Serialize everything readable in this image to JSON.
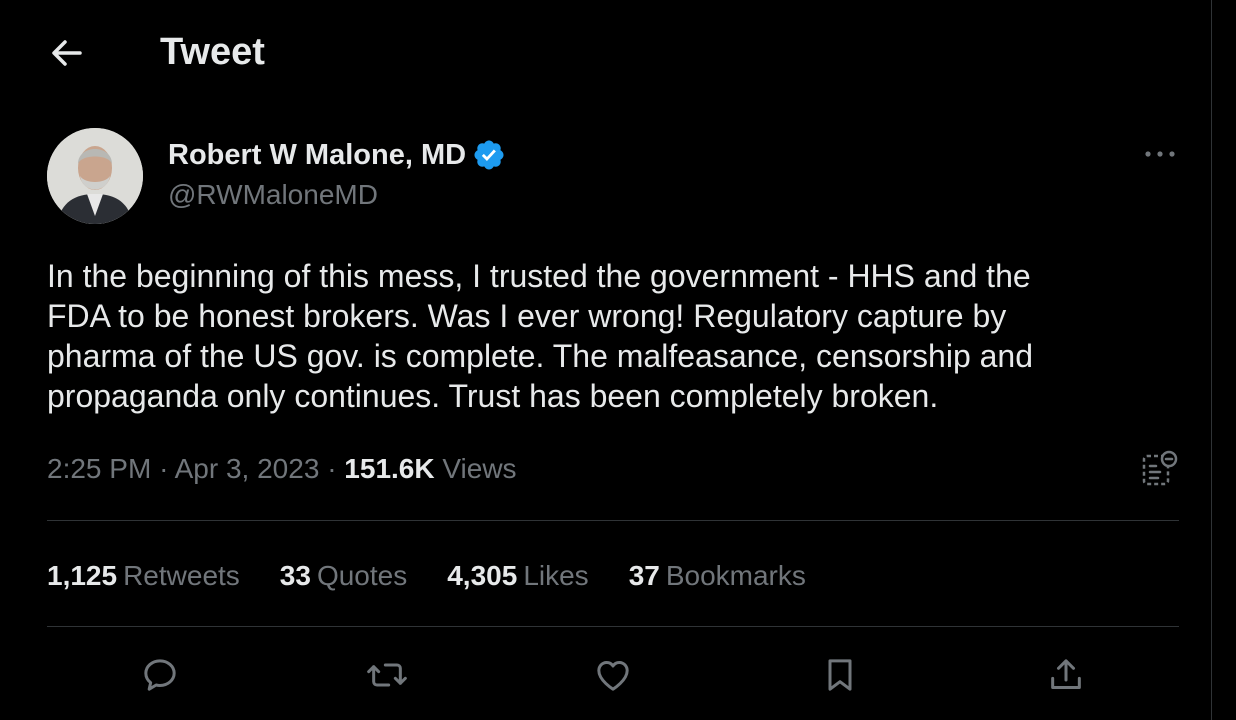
{
  "header": {
    "title": "Tweet",
    "back_icon": "arrow-left-icon"
  },
  "author": {
    "display_name": "Robert W Malone, MD",
    "handle": "@RWMaloneMD",
    "verified": true,
    "verified_color": "#1d9bf0"
  },
  "tweet": {
    "text": "In the beginning of this mess, I trusted the government - HHS and the\nFDA to be honest brokers. Was I ever wrong! Regulatory capture by\npharma of the US gov. is complete. The malfeasance, censorship and\npropaganda only continues. Trust has been completely broken.",
    "time": "2:25 PM",
    "separator": "·",
    "date": "Apr 3, 2023",
    "views_count": "151.6K",
    "views_label": "Views"
  },
  "stats": [
    {
      "count": "1,125",
      "label": "Retweets"
    },
    {
      "count": "33",
      "label": "Quotes"
    },
    {
      "count": "4,305",
      "label": "Likes"
    },
    {
      "count": "37",
      "label": "Bookmarks"
    }
  ],
  "actions": [
    "reply-icon",
    "retweet-icon",
    "like-icon",
    "bookmark-icon",
    "share-icon"
  ],
  "colors": {
    "background": "#000000",
    "text": "#e7e9ea",
    "secondary": "#71767b",
    "divider": "#2f3336"
  }
}
